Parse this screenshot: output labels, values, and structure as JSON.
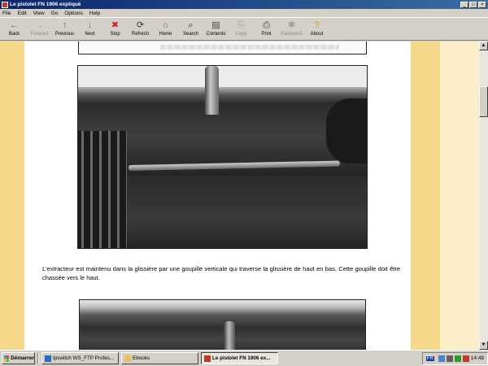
{
  "window": {
    "title": "Le pistolet FN 1906 expliqué",
    "controls": [
      "_",
      "□",
      "×"
    ]
  },
  "menu": [
    "File",
    "Edit",
    "View",
    "Go",
    "Options",
    "Help"
  ],
  "toolbar": [
    {
      "label": "Back",
      "icon": "←",
      "disabled": false,
      "color": "#2a6bbf"
    },
    {
      "label": "Forward",
      "icon": "→",
      "disabled": true,
      "color": "#9a9a9a"
    },
    {
      "label": "Previous",
      "icon": "↑",
      "disabled": false,
      "color": "#2e9a2e"
    },
    {
      "label": "Next",
      "icon": "↓",
      "disabled": false,
      "color": "#2e9a2e"
    },
    {
      "label": "Stop",
      "icon": "✖",
      "disabled": false,
      "color": "#d22020"
    },
    {
      "label": "Refresh",
      "icon": "⟳",
      "disabled": false,
      "color": "#333333"
    },
    {
      "label": "Home",
      "icon": "⌂",
      "disabled": false,
      "color": "#8a5a2a"
    },
    {
      "label": "Search",
      "icon": "⌕",
      "disabled": false,
      "color": "#333333"
    },
    {
      "label": "Contents",
      "icon": "▤",
      "disabled": false,
      "color": "#444444"
    },
    {
      "label": "Copy",
      "icon": "⎘",
      "disabled": true,
      "color": "#9a9a9a"
    },
    {
      "label": "Print",
      "icon": "⎙",
      "disabled": false,
      "color": "#444444"
    },
    {
      "label": "Password",
      "icon": "✱",
      "disabled": true,
      "color": "#9a9a9a"
    },
    {
      "label": "About",
      "icon": "?",
      "disabled": false,
      "color": "#c79a00"
    }
  ],
  "content": {
    "paragraph": "L'extracteur est maintenu dans la glissière par une goupille verticale qui traverse la glissière de haut en bas. Cette goupille doit être chassée vers le haut."
  },
  "taskbar": {
    "start": "Démarrer",
    "tasks": [
      {
        "label": "Ipswitch WS_FTP Profes...",
        "active": false,
        "icon_color": "#2a6bbf"
      },
      {
        "label": "Ebooks",
        "active": false,
        "icon_color": "#e8c15a"
      },
      {
        "label": "Le pistolet FN 1906 ex...",
        "active": true,
        "icon_color": "#c0392b"
      }
    ],
    "lang": "FR",
    "clock": "14:48"
  },
  "colors": {
    "page_margin": "#f6d88a",
    "page_bg": "#ffffff",
    "titlebar": "#0a246a"
  }
}
